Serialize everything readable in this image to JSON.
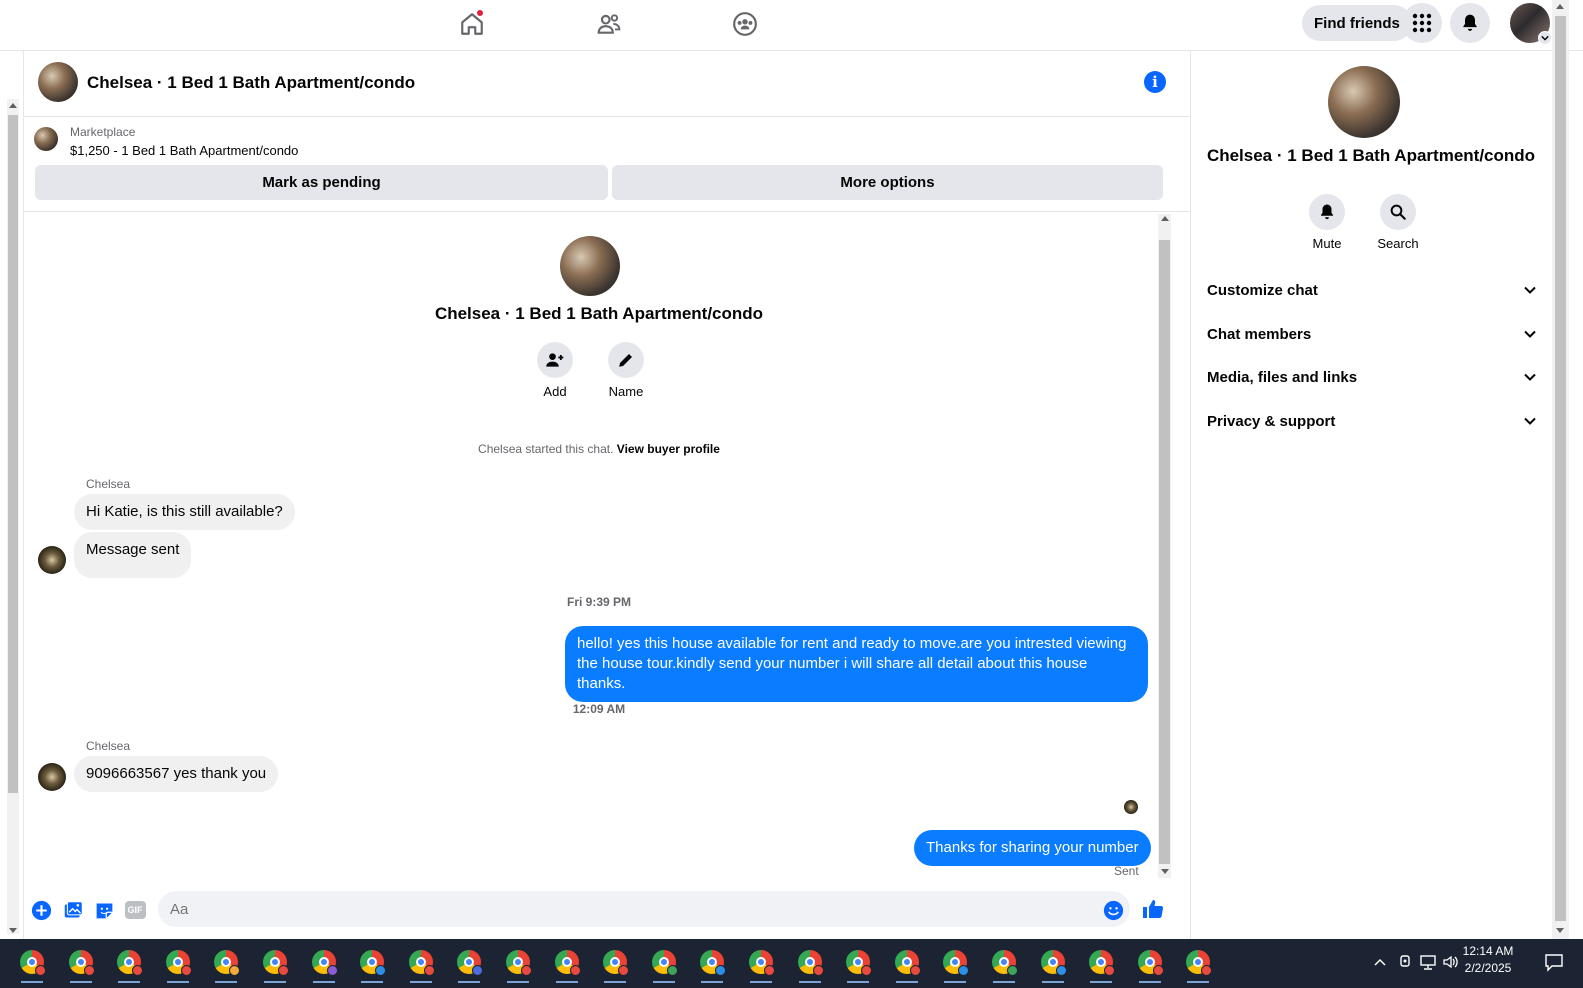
{
  "topnav": {
    "find_friends": "Find friends"
  },
  "header": {
    "title": "Chelsea · 1 Bed 1 Bath Apartment/condo"
  },
  "marketplace": {
    "kicker": "Marketplace",
    "listing": "$1,250 - 1 Bed 1 Bath Apartment/condo",
    "mark_pending": "Mark as pending",
    "more_options": "More options"
  },
  "intro": {
    "title": "Chelsea · 1 Bed 1 Bath Apartment/condo",
    "add_label": "Add",
    "name_label": "Name",
    "started_text": "Chelsea started this chat.",
    "buyer_profile_link": "View buyer profile"
  },
  "messages": {
    "sender1": "Chelsea",
    "m1": "Hi Katie, is this still available?",
    "m2": "Message sent",
    "time1": "Fri 9:39 PM",
    "m3": "hello! yes this house available for rent and ready to move.are you intrested viewing the house tour.kindly send your number i will share all detail about this house thanks.",
    "time2": "12:09 AM",
    "sender2": "Chelsea",
    "m4": "9096663567 yes thank you",
    "m5": "Thanks for sharing your number",
    "status": "Sent"
  },
  "composer": {
    "placeholder": "Aa",
    "gif_label": "GIF"
  },
  "right_panel": {
    "title": "Chelsea · 1 Bed 1 Bath Apartment/condo",
    "mute": "Mute",
    "search": "Search",
    "sections": [
      "Customize chat",
      "Chat members",
      "Media, files and links",
      "Privacy & support"
    ]
  },
  "taskbar": {
    "time": "12:14 AM",
    "date": "2/2/2025",
    "app_badges": [
      "#e94a3f",
      "#e94a3f",
      "#e94a3f",
      "#e94a3f",
      "#f2a93b",
      "#e94a3f",
      "#8e5bd6",
      "#2b8fe8",
      "#e94a3f",
      "#4a6ee0",
      "#e94a3f",
      "#e94a3f",
      "#e94a3f",
      "#3fa35a",
      "#2b8fe8",
      "#e94a3f",
      "#e94a3f",
      "#e94a3f",
      "#e94a3f",
      "#2b8fe8",
      "#3fa35a",
      "#2b8fe8",
      "#e94a3f",
      "#e94a3f",
      "#e94a3f"
    ]
  },
  "colors": {
    "accent": "#0866ff",
    "outgoing_bubble": "#0a7cff",
    "incoming_bubble": "#f0f0f0",
    "taskbar": "#1c2433"
  }
}
